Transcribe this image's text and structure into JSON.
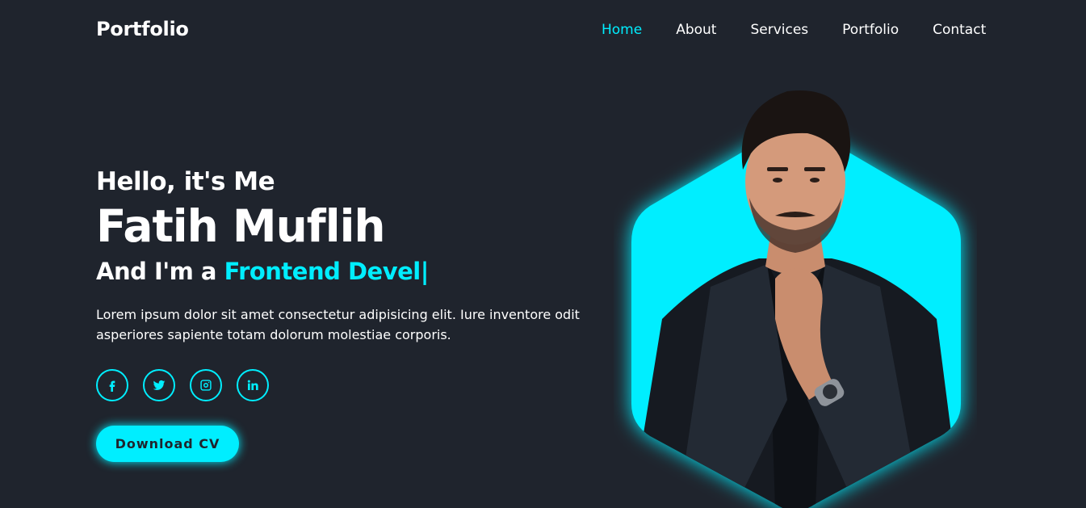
{
  "brand": {
    "logo": "Portfolio"
  },
  "nav": {
    "items": [
      {
        "label": "Home",
        "active": true
      },
      {
        "label": "About"
      },
      {
        "label": "Services"
      },
      {
        "label": "Portfolio"
      },
      {
        "label": "Contact"
      }
    ]
  },
  "hero": {
    "greeting": "Hello, it's Me",
    "name": "Fatih Muflih",
    "role_prefix": "And I'm a",
    "role_typed": "Frontend Devel",
    "cursor": "|",
    "description": "Lorem ipsum dolor sit amet consectetur adipisicing elit. Iure inventore odit asperiores sapiente totam dolorum molestiae corporis.",
    "socials": [
      {
        "icon": "facebook-icon"
      },
      {
        "icon": "twitter-icon"
      },
      {
        "icon": "instagram-icon"
      },
      {
        "icon": "linkedin-icon"
      }
    ],
    "cta": "Download CV"
  },
  "theme": {
    "background": "#1f242d",
    "accent": "#00eeff",
    "text": "#ffffff"
  }
}
